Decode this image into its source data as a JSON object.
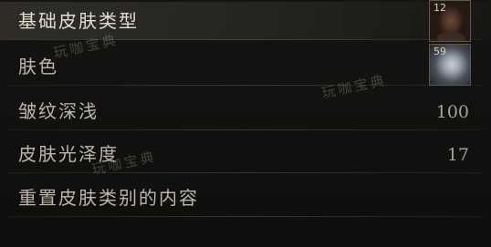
{
  "menu": {
    "items": [
      {
        "label": "基础皮肤类型",
        "thumb_number": "12",
        "thumb_icon": "skin-type-face-icon"
      },
      {
        "label": "肤色",
        "thumb_number": "59",
        "thumb_icon": "skin-color-swatch-icon"
      },
      {
        "label": "皱纹深浅",
        "value": "100"
      },
      {
        "label": "皮肤光泽度",
        "value": "17"
      },
      {
        "label": "重置皮肤类别的内容"
      }
    ]
  },
  "watermarks": [
    "玩咖宝典",
    "玩咖宝典",
    "玩咖宝典"
  ],
  "colors": {
    "background": "#0d0d0c",
    "text": "#bdb6a8",
    "selected_text": "#e4ddcf",
    "selected_bg": "#464238"
  }
}
